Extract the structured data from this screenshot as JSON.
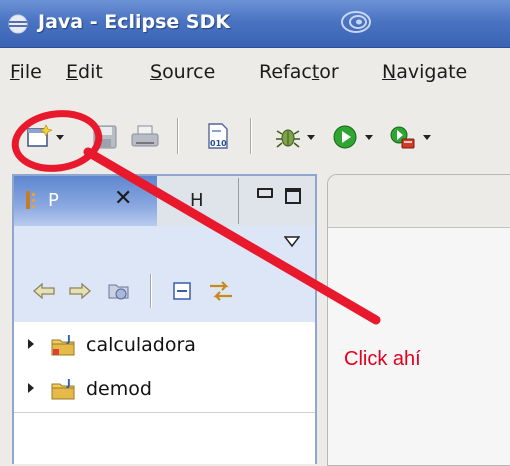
{
  "window": {
    "title": "Java - Eclipse SDK",
    "icons": [
      "eclipse-app-icon",
      "desktop-swirl-icon"
    ]
  },
  "menu": {
    "items": [
      {
        "mnemonic": "F",
        "rest": "ile"
      },
      {
        "mnemonic": "E",
        "rest": "dit"
      },
      {
        "mnemonic": "S",
        "rest": "ource"
      },
      {
        "pre": "Refac",
        "mnemonic": "t",
        "rest": "or"
      },
      {
        "mnemonic": "N",
        "rest": "avigate"
      }
    ]
  },
  "toolbar": {
    "buttons": [
      "new-wizard-icon",
      "save-icon",
      "print-icon",
      "open-type-icon",
      "debug-icon",
      "run-icon",
      "external-tools-icon"
    ]
  },
  "package_explorer": {
    "tab_label": "P",
    "tab_close": "✕",
    "second_tab_label": "H",
    "projects": [
      {
        "name": "calculadora"
      },
      {
        "name": "demod"
      }
    ]
  },
  "annotation": {
    "text": "Click ahí",
    "color": "#e1001e"
  }
}
